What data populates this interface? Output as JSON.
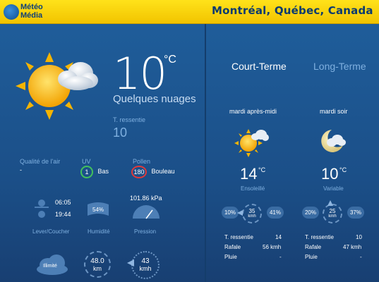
{
  "header": {
    "logo_line1": "Météo",
    "logo_line2": "Média",
    "city": "Montréal, Québec, Canada"
  },
  "current": {
    "temp": "10",
    "unit": "°C",
    "condition": "Quelques nuages",
    "feels_label": "T. ressentie",
    "feels_value": "10"
  },
  "air": {
    "label": "Qualité de l'air",
    "value": "-"
  },
  "uv": {
    "label": "UV",
    "value": "1",
    "desc": "Bas",
    "color": "#43c25b"
  },
  "pollen": {
    "label": "Pollen",
    "value": "180",
    "desc": "Bouleau",
    "color": "#e03a3a"
  },
  "sun": {
    "rise": "06:05",
    "set": "19:44",
    "label": "Lever/Coucher"
  },
  "humidity": {
    "value": "54%",
    "label": "Humidité"
  },
  "pressure": {
    "value": "101.86 kPa",
    "label": "Pression"
  },
  "visibility": {
    "value": "Illimité"
  },
  "wind_now": {
    "value": "48.0",
    "unit": "km"
  },
  "gust_now": {
    "value": "43",
    "unit": "kmh"
  },
  "tabs": {
    "short": "Court-Terme",
    "long": "Long-Terme"
  },
  "forecast": [
    {
      "period": "mardi après-midi",
      "temp": "14",
      "unit": "°C",
      "cond": "Ensoleillé",
      "pop": "10%",
      "wind_val": "35",
      "wind_unit": "kmh",
      "humidity": "41%",
      "feels_label": "T. ressentie",
      "feels": "14",
      "gust_label": "Rafale",
      "gust": "56 kmh",
      "rain_label": "Pluie",
      "rain": "-"
    },
    {
      "period": "mardi soir",
      "temp": "10",
      "unit": "°C",
      "cond": "Variable",
      "pop": "20%",
      "wind_val": "25",
      "wind_unit": "kmh",
      "humidity": "37%",
      "feels_label": "T. ressentie",
      "feels": "10",
      "gust_label": "Rafale",
      "gust": "47 kmh",
      "rain_label": "Pluie",
      "rain": "-"
    }
  ]
}
